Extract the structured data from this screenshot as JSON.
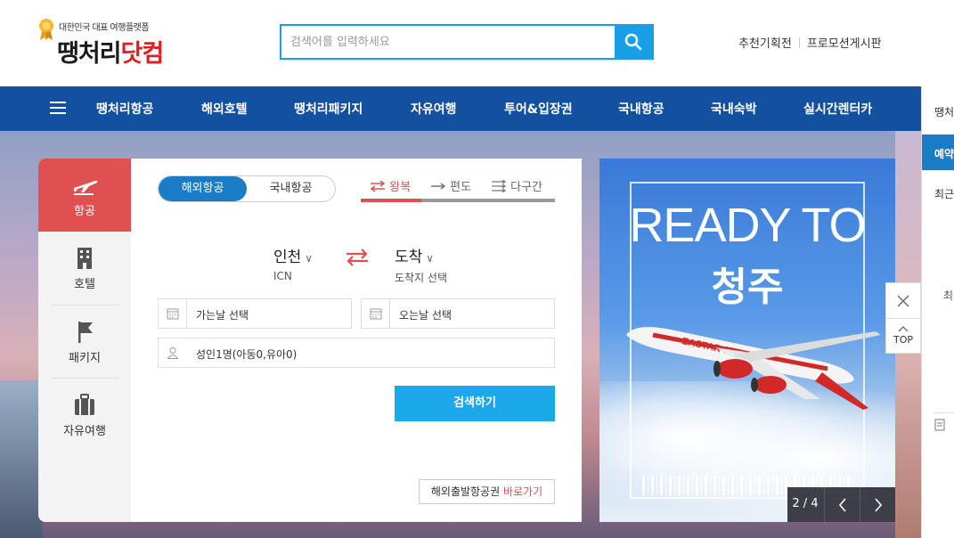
{
  "header": {
    "logo_tagline": "대한민국 대표 여행플랫폼",
    "logo_name_main": "땡처리",
    "logo_name_dot": "닷컴",
    "search_placeholder": "검색어를 입력하세요",
    "links": [
      "추천기획전",
      "프로모션게시판"
    ]
  },
  "nav": {
    "items": [
      "땡처리항공",
      "해외호텔",
      "땡처리패키지",
      "자유여행",
      "투어&입장권",
      "국내항공",
      "국내숙박",
      "실시간렌터카"
    ]
  },
  "side_tabs": [
    {
      "label": "항공",
      "icon": "airplane-icon",
      "active": true
    },
    {
      "label": "호텔",
      "icon": "building-icon",
      "active": false
    },
    {
      "label": "패키지",
      "icon": "flag-icon",
      "active": false
    },
    {
      "label": "자유여행",
      "icon": "suitcase-icon",
      "active": false
    }
  ],
  "flight": {
    "segment": [
      "해외항공",
      "국내항공"
    ],
    "trip_types": [
      "왕복",
      "편도",
      "다구간"
    ],
    "origin": {
      "city": "인천",
      "code": "ICN"
    },
    "destination": {
      "city": "도착",
      "code": "도착지 선택"
    },
    "depart_placeholder": "가는날 선택",
    "return_placeholder": "오는날 선택",
    "passengers": "성인1명(아동0,유아0)",
    "search_button": "검색하기",
    "intl_link_text": "해외출발항공권",
    "intl_link_action": "바로가기"
  },
  "banner": {
    "title_line1": "READY TO",
    "title_line2": "청주",
    "airline_text": "EASTAR JET",
    "pager": "2 / 4"
  },
  "floating": {
    "top_label": "TOP"
  },
  "right_panel": {
    "item1": "땡처",
    "item2": "예약",
    "item3": "최근",
    "item4": "최"
  },
  "colors": {
    "nav_bg": "#1450a0",
    "accent_blue": "#1aa8ea",
    "accent_red": "#e05050"
  }
}
